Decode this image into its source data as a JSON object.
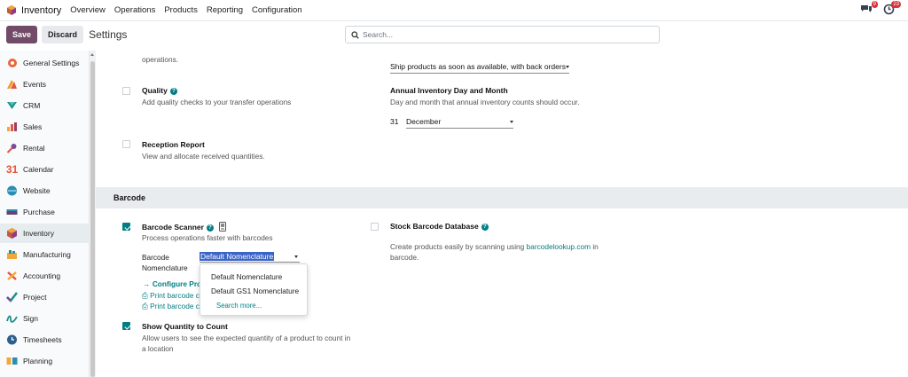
{
  "navbar": {
    "app_name": "Inventory",
    "links": [
      "Overview",
      "Operations",
      "Products",
      "Reporting",
      "Configuration"
    ],
    "chat_badge": "9",
    "activity_badge": "23"
  },
  "control": {
    "save_label": "Save",
    "discard_label": "Discard",
    "title": "Settings",
    "search_placeholder": "Search..."
  },
  "sidebar": {
    "items": [
      {
        "label": "General Settings",
        "icon": "gear-icon"
      },
      {
        "label": "Events",
        "icon": "events-icon"
      },
      {
        "label": "CRM",
        "icon": "crm-icon"
      },
      {
        "label": "Sales",
        "icon": "sales-icon"
      },
      {
        "label": "Rental",
        "icon": "rental-icon"
      },
      {
        "label": "Calendar",
        "icon": "calendar-icon"
      },
      {
        "label": "Website",
        "icon": "website-icon"
      },
      {
        "label": "Purchase",
        "icon": "purchase-icon"
      },
      {
        "label": "Inventory",
        "icon": "inventory-icon"
      },
      {
        "label": "Manufacturing",
        "icon": "manufacturing-icon"
      },
      {
        "label": "Accounting",
        "icon": "accounting-icon"
      },
      {
        "label": "Project",
        "icon": "project-icon"
      },
      {
        "label": "Sign",
        "icon": "sign-icon"
      },
      {
        "label": "Timesheets",
        "icon": "timesheets-icon"
      },
      {
        "label": "Planning",
        "icon": "planning-icon"
      }
    ],
    "active": "Inventory"
  },
  "settings": {
    "operations_tail": "operations.",
    "shipping_policy_value": "Ship products as soon as available, with back orders",
    "quality_title": "Quality",
    "quality_desc": "Add quality checks to your transfer operations",
    "annual_title": "Annual Inventory Day and Month",
    "annual_desc": "Day and month that annual inventory counts should occur.",
    "annual_day": "31",
    "annual_month": "December",
    "reception_title": "Reception Report",
    "reception_desc": "View and allocate received quantities.",
    "barcode_section": "Barcode",
    "scanner_title": "Barcode Scanner",
    "scanner_desc": "Process operations faster with barcodes",
    "nomenclature_label_1": "Barcode",
    "nomenclature_label_2": "Nomenclature",
    "nomenclature_value": "Default Nomenclature",
    "configure_link": "Configure Pro",
    "print_link_1": "Print barcode c",
    "print_link_2": "Print barcode c",
    "show_qty_title": "Show Quantity to Count",
    "show_qty_desc_1": "Allow users to see the expected quantity of a product to count in",
    "show_qty_desc_2": "a location",
    "stock_db_title": "Stock Barcode Database",
    "stock_db_desc_1": "Create products easily by scanning using",
    "stock_db_link": "barcodelookup.com",
    "stock_db_desc_2": "in",
    "stock_db_desc_3": "barcode."
  },
  "dropdown": {
    "options": [
      "Default Nomenclature",
      "Default GS1 Nomenclature"
    ],
    "more": "Search more..."
  },
  "colors": {
    "brand": "#714b67",
    "accent": "#017e84",
    "badge": "#d9323a"
  }
}
